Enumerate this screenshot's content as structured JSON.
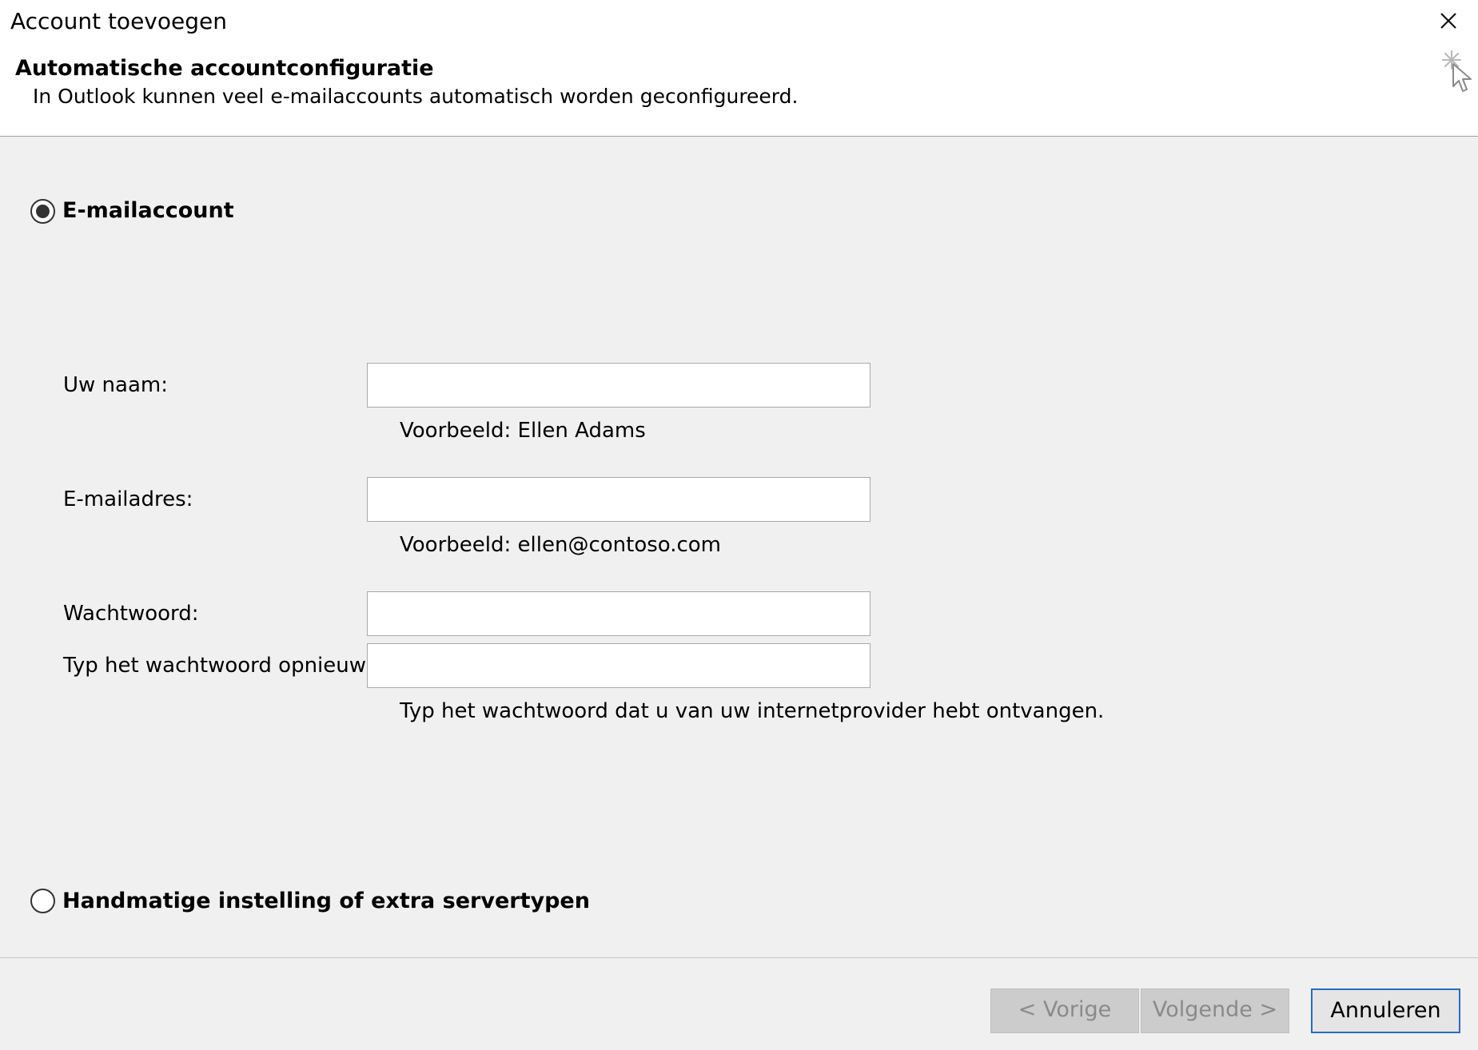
{
  "window": {
    "title": "Account toevoegen",
    "close_icon": "close-icon"
  },
  "header": {
    "heading": "Automatische accountconfiguratie",
    "subheading": "In Outlook kunnen veel e-mailaccounts automatisch worden geconfigureerd.",
    "icon": "wizard-cursor-icon"
  },
  "options": {
    "email_account": {
      "label": "E-mailaccount",
      "selected": true
    },
    "manual_setup": {
      "label": "Handmatige instelling of extra servertypen",
      "selected": false
    }
  },
  "form": {
    "name": {
      "label": "Uw naam:",
      "value": "",
      "hint": "Voorbeeld: Ellen Adams"
    },
    "email": {
      "label": "E-mailadres:",
      "value": "",
      "hint": "Voorbeeld: ellen@contoso.com"
    },
    "password": {
      "label": "Wachtwoord:",
      "value": ""
    },
    "password_repeat": {
      "label": "Typ het wachtwoord opnieuw:",
      "value": "",
      "hint": "Typ het wachtwoord dat u van uw internetprovider hebt ontvangen."
    }
  },
  "buttons": {
    "back": {
      "label": "< Vorige",
      "enabled": false
    },
    "next": {
      "label": "Volgende >",
      "enabled": false
    },
    "cancel": {
      "label": "Annuleren",
      "enabled": true
    }
  },
  "colors": {
    "dialog_background": "#f0f0f0",
    "header_background": "#ffffff",
    "focus_border": "#2a6cc2",
    "disabled_button": "#cccccc"
  }
}
